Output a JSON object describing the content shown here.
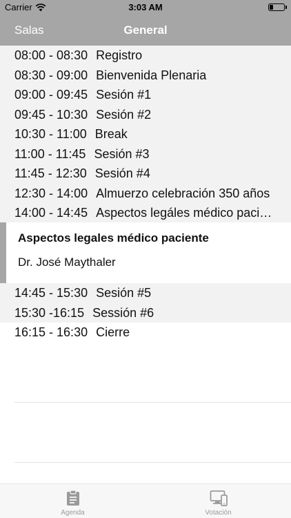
{
  "status_bar": {
    "carrier": "Carrier",
    "time": "3:03 AM",
    "wifi_icon": "wifi-icon",
    "battery_icon": "battery-icon",
    "battery_level": 0.25
  },
  "nav": {
    "back_label": "Salas",
    "title": "General"
  },
  "agenda": {
    "items": [
      {
        "time": "08:00 - 08:30",
        "title": "Registro"
      },
      {
        "time": "08:30 - 09:00",
        "title": "Bienvenida Plenaria"
      },
      {
        "time": "09:00 - 09:45",
        "title": "Sesión #1"
      },
      {
        "time": "09:45 - 10:30",
        "title": "Sesión #2"
      },
      {
        "time": "10:30 - 11:00",
        "title": "Break"
      },
      {
        "time": "11:00 - 11:45",
        "title": "Sesión #3"
      },
      {
        "time": "11:45 - 12:30",
        "title": "Sesión #4"
      },
      {
        "time": "12:30 - 14:00",
        "title": "Almuerzo celebración 350 años"
      },
      {
        "time": "14:00 - 14:45",
        "title": "Aspectos legáles médico paciente"
      },
      {
        "time": "14:45 - 15:30",
        "title": "Sesión #5"
      },
      {
        "time": "15:30 -16:15",
        "title": "Sessión #6"
      },
      {
        "time": "16:15 - 16:30",
        "title": "Cierre"
      }
    ]
  },
  "detail": {
    "title": "Aspectos legales médico paciente",
    "speaker": "Dr. José Maythaler"
  },
  "tab_bar": {
    "tabs": [
      {
        "label": "Agenda",
        "icon": "clipboard-icon"
      },
      {
        "label": "Votación",
        "icon": "devices-icon"
      }
    ]
  }
}
